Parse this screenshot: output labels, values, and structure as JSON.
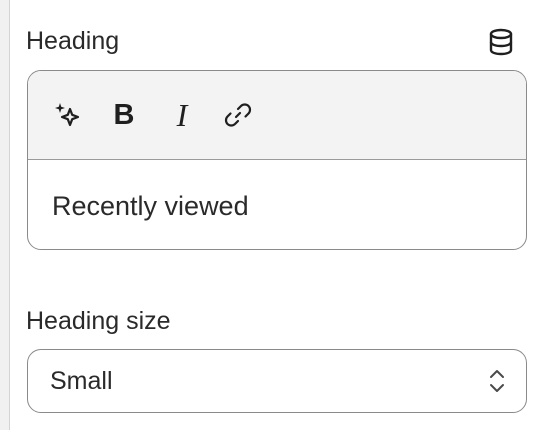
{
  "heading_field": {
    "label": "Heading",
    "source_icon": "database-icon",
    "value": "Recently viewed",
    "toolbar": [
      {
        "name": "ai-sparkle",
        "icon": "sparkle-icon"
      },
      {
        "name": "bold",
        "glyph": "B"
      },
      {
        "name": "italic",
        "glyph": "I"
      },
      {
        "name": "link",
        "icon": "link-icon"
      }
    ]
  },
  "heading_size": {
    "label": "Heading size",
    "selected": "Small",
    "icon": "chevron-up-down-icon"
  },
  "colors": {
    "border": "#8a8a8a",
    "toolbar_bg": "#f3f3f3",
    "text": "#2a2a2a"
  }
}
